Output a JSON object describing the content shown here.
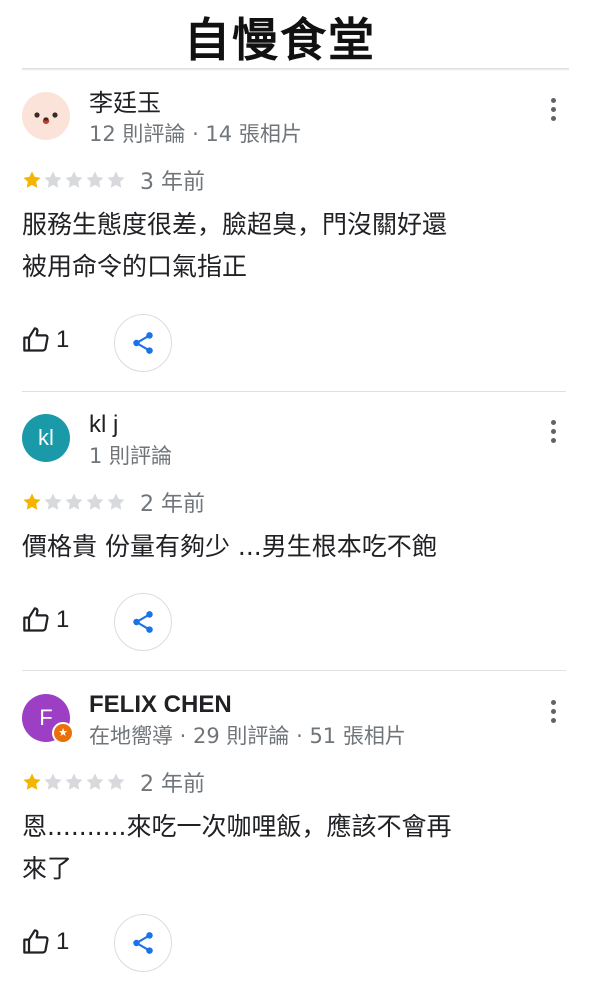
{
  "header": {
    "title": "自慢食堂"
  },
  "colors": {
    "star_filled": "#f4b400",
    "star_empty": "#d7d9dc",
    "share_icon": "#1a73e8",
    "avatar_1": "#fbe3da",
    "avatar_2": "#1a9aa8",
    "avatar_3": "#9c3fc4",
    "local_guide_badge": "#e8710a"
  },
  "reviews": [
    {
      "name": "李廷玉",
      "avatar": {
        "type": "emoji-face-icon",
        "letter": ""
      },
      "meta": "12 則評論 · 14 張相片",
      "rating": 1,
      "rating_max": 5,
      "time": "3 年前",
      "text_lines": [
        "服務生態度很差，臉超臭，門沒關好還",
        "被用命令的口氣指正"
      ],
      "likes": "1"
    },
    {
      "name": "kl j",
      "avatar": {
        "type": "letter",
        "letter": "kl"
      },
      "meta": "1 則評論",
      "rating": 1,
      "rating_max": 5,
      "time": "2 年前",
      "text_lines": [
        "價格貴 份量有夠少 ...男生根本吃不飽"
      ],
      "likes": "1"
    },
    {
      "name": "FELIX CHEN",
      "avatar": {
        "type": "letter",
        "letter": "F",
        "badge": "local-guide-star-icon"
      },
      "meta": "在地嚮導 · 29 則評論 · 51 張相片",
      "rating": 1,
      "rating_max": 5,
      "time": "2 年前",
      "text_lines": [
        "恩..........來吃一次咖哩飯，應該不會再",
        "來了"
      ],
      "likes": "1"
    }
  ]
}
